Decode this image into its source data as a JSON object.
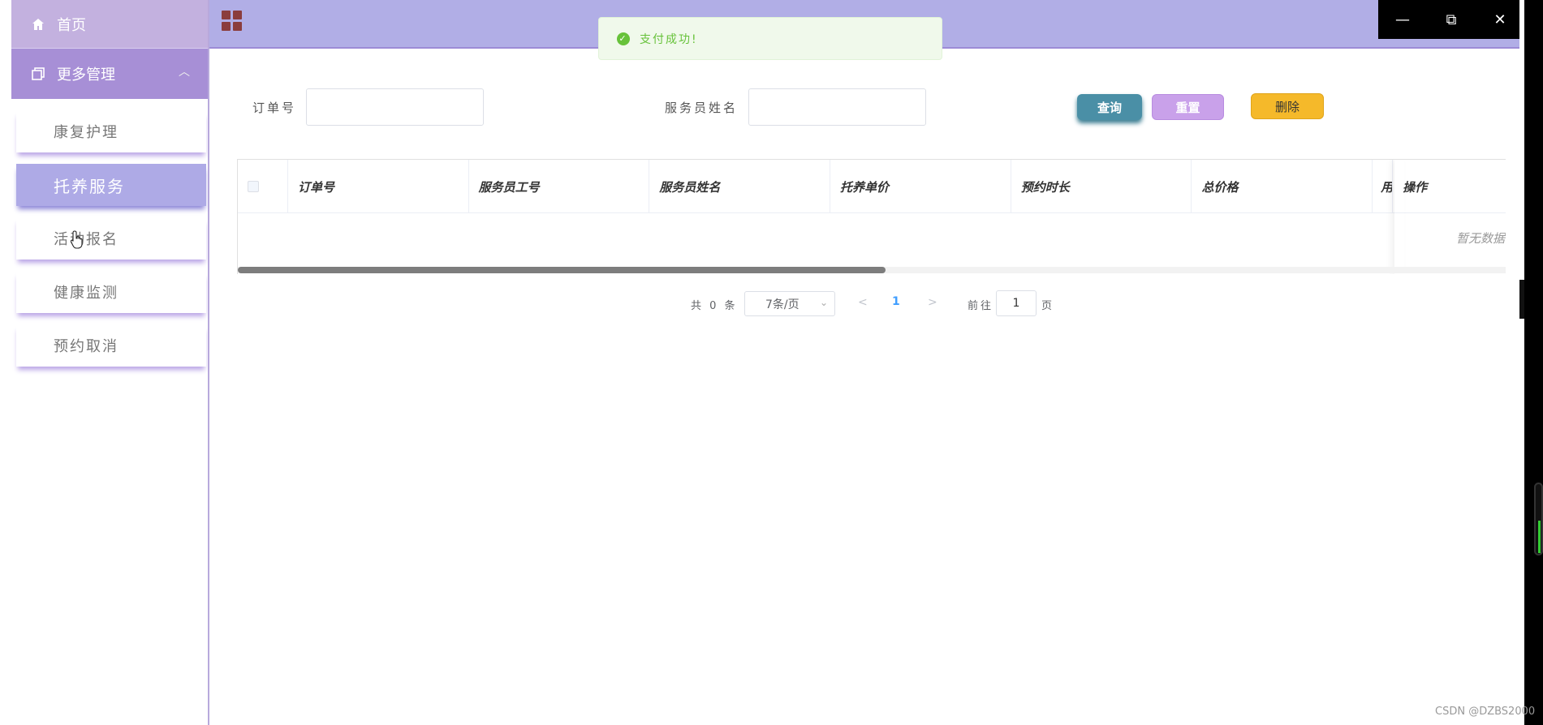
{
  "window": {
    "minimize_icon": "minimize-icon",
    "restore_icon": "restore-icon",
    "close_icon": "close-icon"
  },
  "sidebar": {
    "home_label": "首页",
    "group_label": "更多管理",
    "items": [
      {
        "label": "康复护理",
        "active": false
      },
      {
        "label": "托养服务",
        "active": true
      },
      {
        "label": "活动报名",
        "active": false
      },
      {
        "label": "健康监测",
        "active": false
      },
      {
        "label": "预约取消",
        "active": false
      }
    ]
  },
  "toast": {
    "message": "支付成功!"
  },
  "search": {
    "order_label": "订单号",
    "order_value": "",
    "staff_label": "服务员姓名",
    "staff_value": "",
    "query_button": "查询",
    "reset_button": "重置",
    "delete_button": "删除"
  },
  "table": {
    "columns": [
      "订单号",
      "服务员工号",
      "服务员姓名",
      "托养单价",
      "预约时长",
      "总价格",
      "用",
      "操作"
    ],
    "empty_text": "暂无数据",
    "rows": []
  },
  "pagination": {
    "total_text": "共 0 条",
    "page_size": "7条/页",
    "current_page": "1",
    "goto_label": "前往",
    "goto_value": "1",
    "page_suffix": "页"
  },
  "watermark": "CSDN @DZBS2000",
  "colors": {
    "header_bg": "#b1aee6",
    "sidebar_group_bg": "#a78fd6",
    "sidebar_active_bg": "#aeaae6",
    "toast_green": "#67c23a",
    "query_btn": "#4a8fa6",
    "reset_btn": "#c9a1ea",
    "delete_btn": "#f5b92a"
  }
}
